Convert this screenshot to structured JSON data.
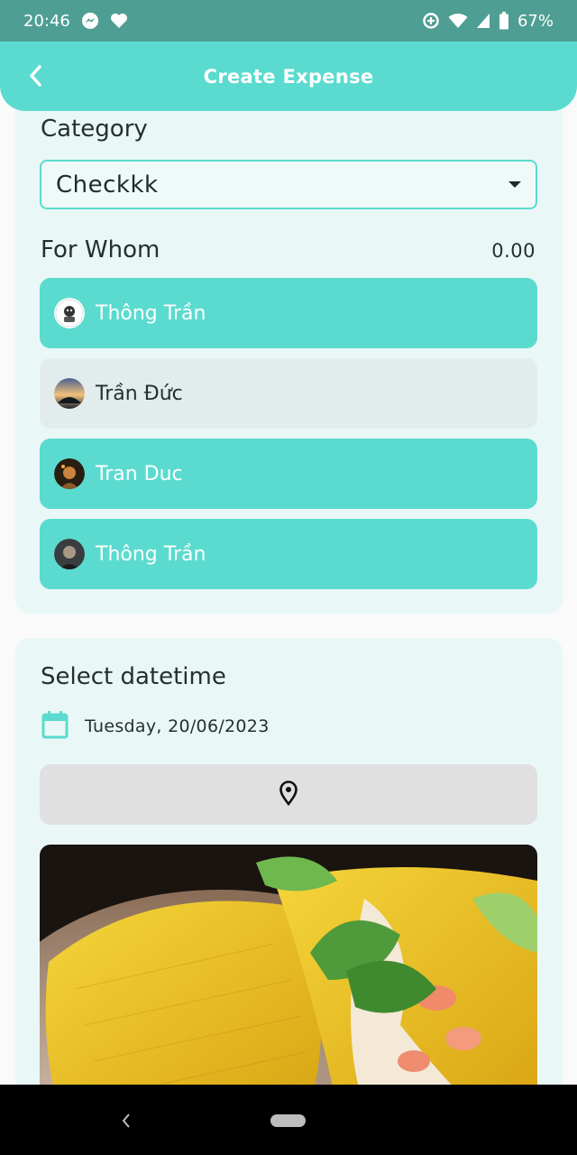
{
  "status_bar": {
    "time": "20:46",
    "battery": "67%",
    "icons": [
      "messenger-icon",
      "heart-icon",
      "data-saver-icon",
      "wifi-icon",
      "signal-icon",
      "battery-icon"
    ]
  },
  "header": {
    "title": "Create Expense",
    "back_icon": "back-arrow-icon"
  },
  "category": {
    "label": "Category",
    "selected": "Checkkk"
  },
  "for_whom": {
    "label": "For Whom",
    "amount": "0.00",
    "people": [
      {
        "name": "Thông Trần",
        "selected": true
      },
      {
        "name": "Trần Đức",
        "selected": false
      },
      {
        "name": "Tran Duc",
        "selected": true
      },
      {
        "name": "Thông Trần",
        "selected": true
      }
    ]
  },
  "datetime": {
    "label": "Select datetime",
    "date": "Tuesday, 20/06/2023",
    "icon": "calendar-icon"
  },
  "location": {
    "icon": "location-pin-icon"
  },
  "colors": {
    "accent": "#5bdbcf",
    "status_bar": "#4f9e93",
    "card": "#e9f7f6",
    "unselected": "#e3ecec",
    "location_button": "#e0e0e0"
  }
}
